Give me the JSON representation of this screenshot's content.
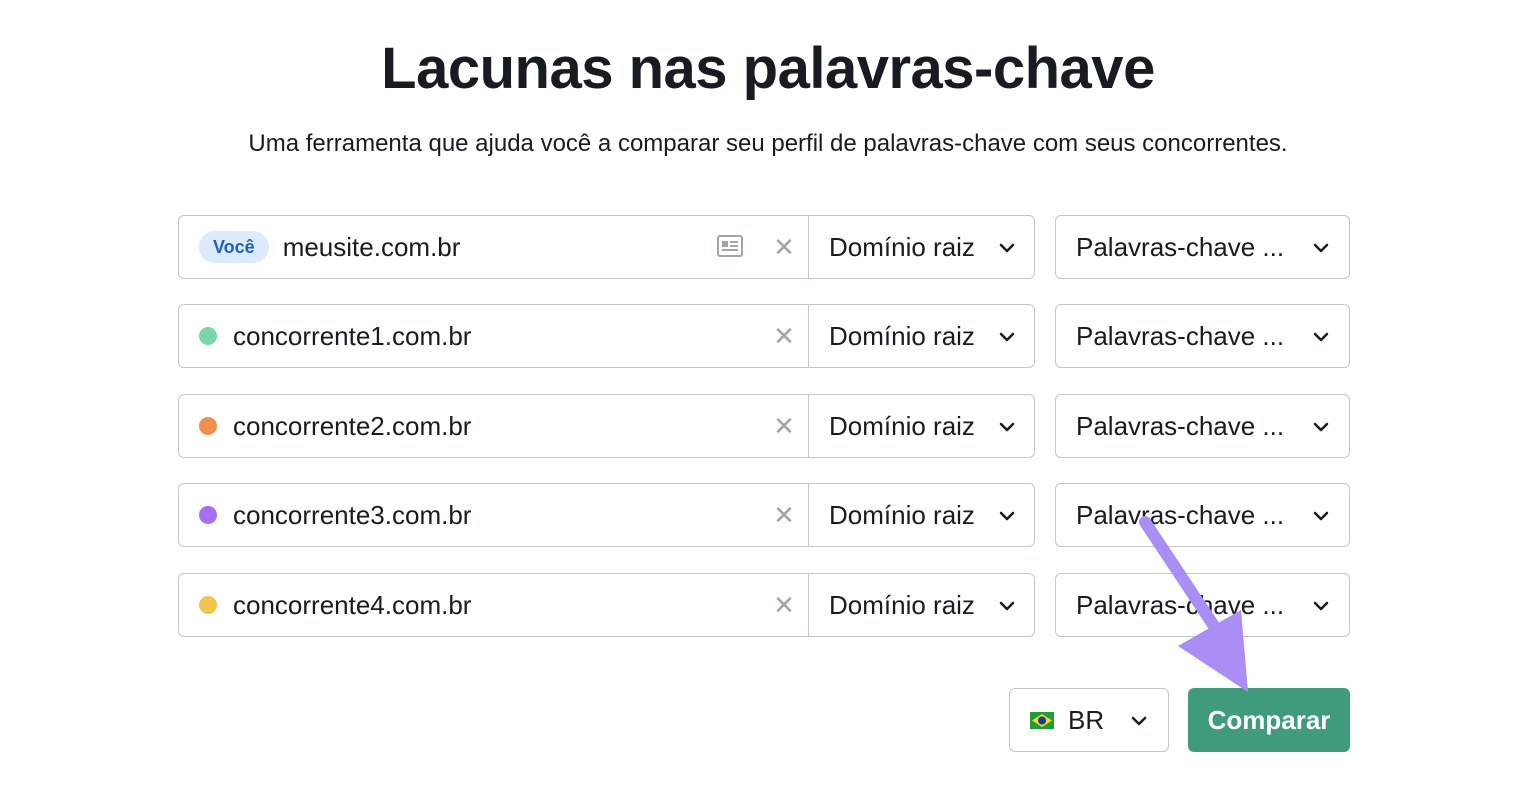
{
  "header": {
    "title": "Lacunas nas palavras-chave",
    "subtitle": "Uma ferramenta que ajuda você a comparar seu perfil de palavras-chave com seus concorrentes."
  },
  "rows": [
    {
      "badge": "Você",
      "domain": "meusite.com.br",
      "dot_color": null,
      "scope": "Domínio raiz",
      "keyword_type": "Palavras-chave ..."
    },
    {
      "badge": null,
      "domain": "concorrente1.com.br",
      "dot_color": "#79d6ab",
      "scope": "Domínio raiz",
      "keyword_type": "Palavras-chave ..."
    },
    {
      "badge": null,
      "domain": "concorrente2.com.br",
      "dot_color": "#f0904f",
      "scope": "Domínio raiz",
      "keyword_type": "Palavras-chave ..."
    },
    {
      "badge": null,
      "domain": "concorrente3.com.br",
      "dot_color": "#a66ef0",
      "scope": "Domínio raiz",
      "keyword_type": "Palavras-chave ..."
    },
    {
      "badge": null,
      "domain": "concorrente4.com.br",
      "dot_color": "#f3c54e",
      "scope": "Domínio raiz",
      "keyword_type": "Palavras-chave ..."
    }
  ],
  "footer": {
    "country": "BR",
    "compare_label": "Comparar"
  },
  "colors": {
    "accent_button": "#3f9b7b",
    "annotation_arrow": "#ab8ef5",
    "you_badge_bg": "#dbeafe"
  },
  "icons": {
    "card": "contact-card-icon",
    "clear": "close-icon",
    "chevron": "chevron-down-icon",
    "flag": "brazil-flag-icon"
  }
}
